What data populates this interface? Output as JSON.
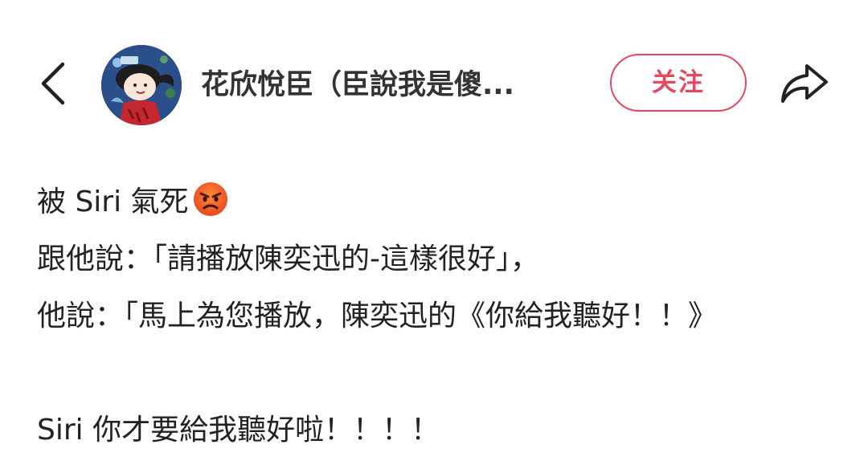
{
  "header": {
    "author_name": "花欣悅臣（臣說我是傻...",
    "follow_label": "关注",
    "back_icon": "chevron-left-icon",
    "share_icon": "share-arrow-icon"
  },
  "post": {
    "line1_text": "被 Siri 氣死",
    "line1_emoji": "angry-face-emoji",
    "line2": "跟他說：「請播放陳奕迅的-這樣很好」，",
    "line3": "他說：「馬上為您播放，陳奕迅的《你給我聽好！！》",
    "line4": "Siri 你才要給我聽好啦！！！！"
  },
  "colors": {
    "accent": "#e8475f",
    "text": "#222222",
    "avatar_bg": "#2a4f8a",
    "emoji_face": "#f26a2e"
  }
}
